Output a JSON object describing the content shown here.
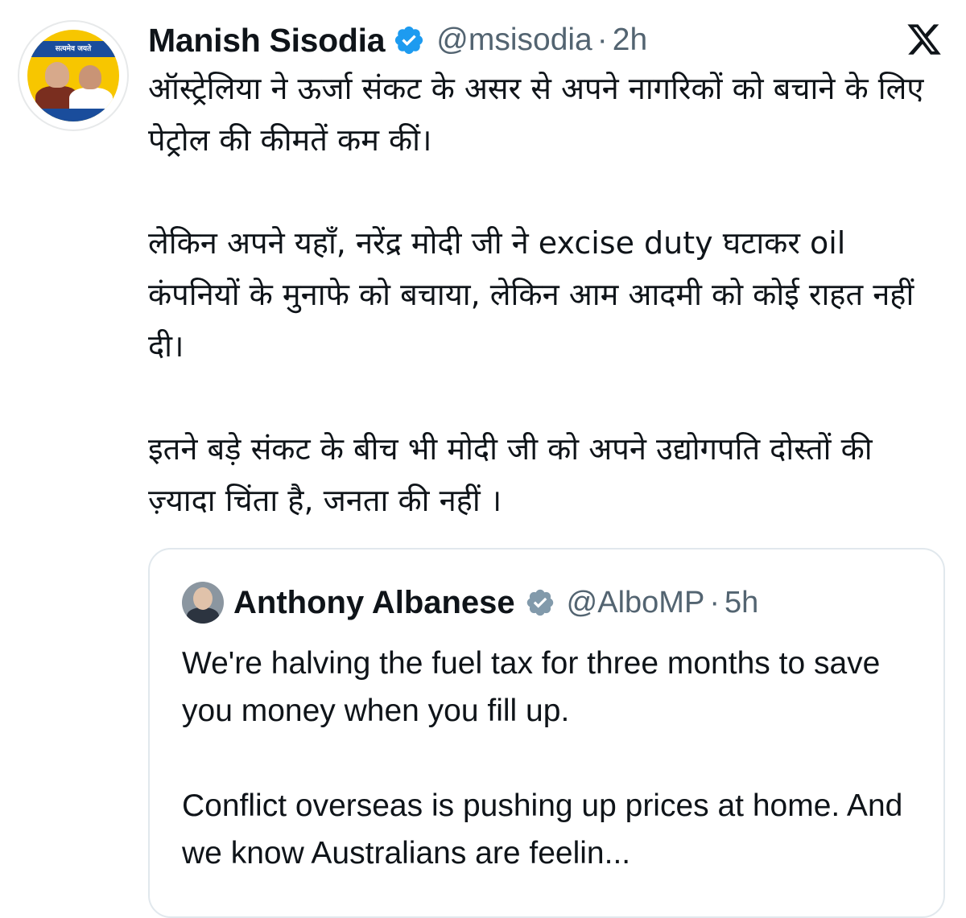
{
  "tweet": {
    "author": {
      "name": "Manish Sisodia",
      "handle": "@msisodia",
      "time": "2h",
      "separator": "·",
      "avatar_banner_text": "सत्यमेव जयते"
    },
    "paragraphs": [
      "ऑस्ट्रेलिया ने ऊर्जा संकट के असर से अपने नागरिकों को बचाने के लिए पेट्रोल की कीमतें कम कीं।",
      "लेकिन अपने यहाँ, नरेंद्र मोदी जी ने excise duty घटाकर oil कंपनियों के मुनाफे को बचाया, लेकिन आम आदमी को कोई राहत नहीं दी।",
      "इतने बड़े संकट के बीच भी मोदी जी को अपने उद्योगपति दोस्तों की ज़्यादा चिंता है, जनता की नहीं ।"
    ],
    "platform_icon": "x-logo-icon"
  },
  "quoted_tweet": {
    "author": {
      "name": "Anthony Albanese",
      "handle": "@AlboMP",
      "time": "5h",
      "separator": "·"
    },
    "paragraphs": [
      "We're halving the fuel tax for three months to save you money when you fill up.",
      "Conflict overseas is pushing up prices at home. And we know Australians are feelin..."
    ]
  },
  "colors": {
    "verified_blue": "#1d9bf0",
    "verified_gray": "#829aab",
    "secondary_text": "#536471",
    "primary_text": "#0f1419",
    "card_border": "#e1e8ed"
  }
}
